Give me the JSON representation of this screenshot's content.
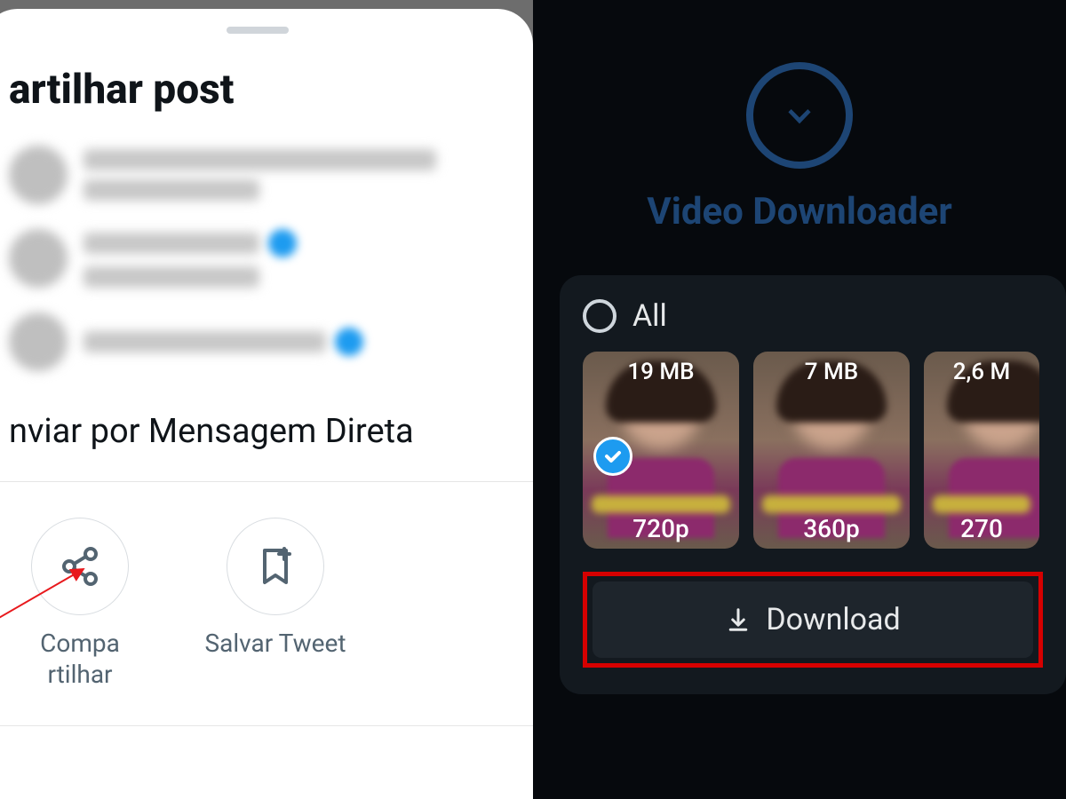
{
  "left": {
    "sheet_title": "artilhar post",
    "dm_label": "nviar por Mensagem Direta",
    "actions": {
      "share_label": "Compa rtilhar",
      "save_label": "Salvar Tweet"
    }
  },
  "right": {
    "app_title": "Video Downloader",
    "all_label": "All",
    "thumbs": [
      {
        "size": "19 MB",
        "res": "720p",
        "selected": true
      },
      {
        "size": "7 MB",
        "res": "360p",
        "selected": false
      },
      {
        "size": "2,6 M",
        "res": "270",
        "selected": false
      }
    ],
    "download_label": "Download"
  }
}
